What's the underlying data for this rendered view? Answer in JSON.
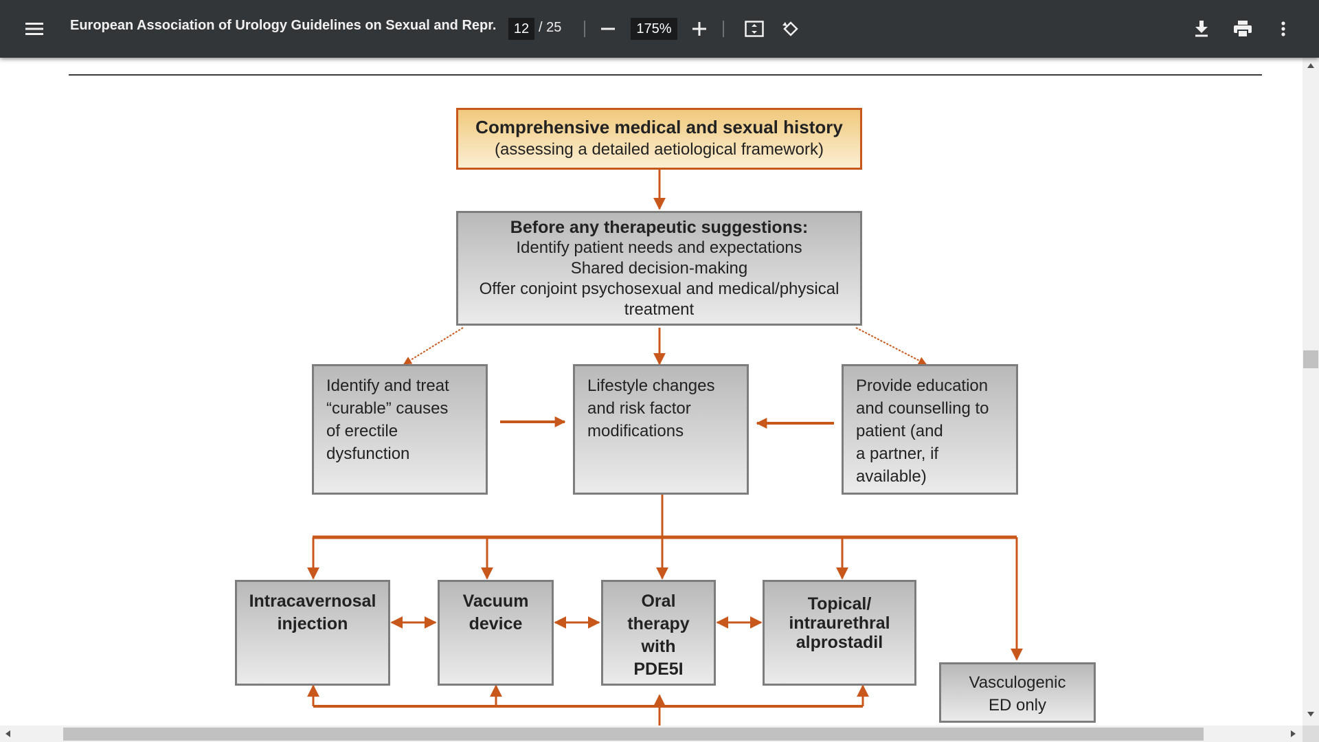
{
  "toolbar": {
    "title": "European Association of Urology Guidelines on Sexual and Repr...",
    "page_current": "12",
    "page_total": "/ 25",
    "zoom": "175%",
    "icons": [
      "menu-icon",
      "zoom-out-icon",
      "zoom-in-icon",
      "fit-to-page-icon",
      "rotate-icon",
      "download-icon",
      "print-icon",
      "more-options-icon"
    ]
  },
  "flowchart": {
    "history": {
      "title": "Comprehensive medical and sexual history",
      "subtitle": "(assessing a detailed aetiological framework)"
    },
    "before": {
      "title": "Before any therapeutic suggestions:",
      "lines": [
        "Identify patient needs and expectations",
        "Shared decision-making",
        "Offer conjoint psychosexual and medical/physical",
        "treatment"
      ]
    },
    "curable": [
      "Identify and treat",
      "“curable” causes",
      "of erectile",
      "dysfunction"
    ],
    "lifestyle": [
      "Lifestyle changes",
      "and risk factor",
      "modifications"
    ],
    "education": [
      "Provide education",
      "and counselling to",
      "patient (and",
      "a partner, if",
      "available)"
    ],
    "treatments": {
      "ici": [
        "Intracavernosal",
        "injection"
      ],
      "vacuum": [
        "Vacuum",
        "device"
      ],
      "oral": [
        "Oral",
        "therapy",
        "with",
        "PDE5I"
      ],
      "topical": [
        "Topical/",
        "intraurethral",
        "alprostadil"
      ],
      "vasculogenic": [
        "Vasculogenic",
        "ED only"
      ]
    },
    "colors": {
      "arrow": "#c8571b",
      "box_border": "#7d7d7d",
      "top_border": "#c8571b"
    }
  }
}
